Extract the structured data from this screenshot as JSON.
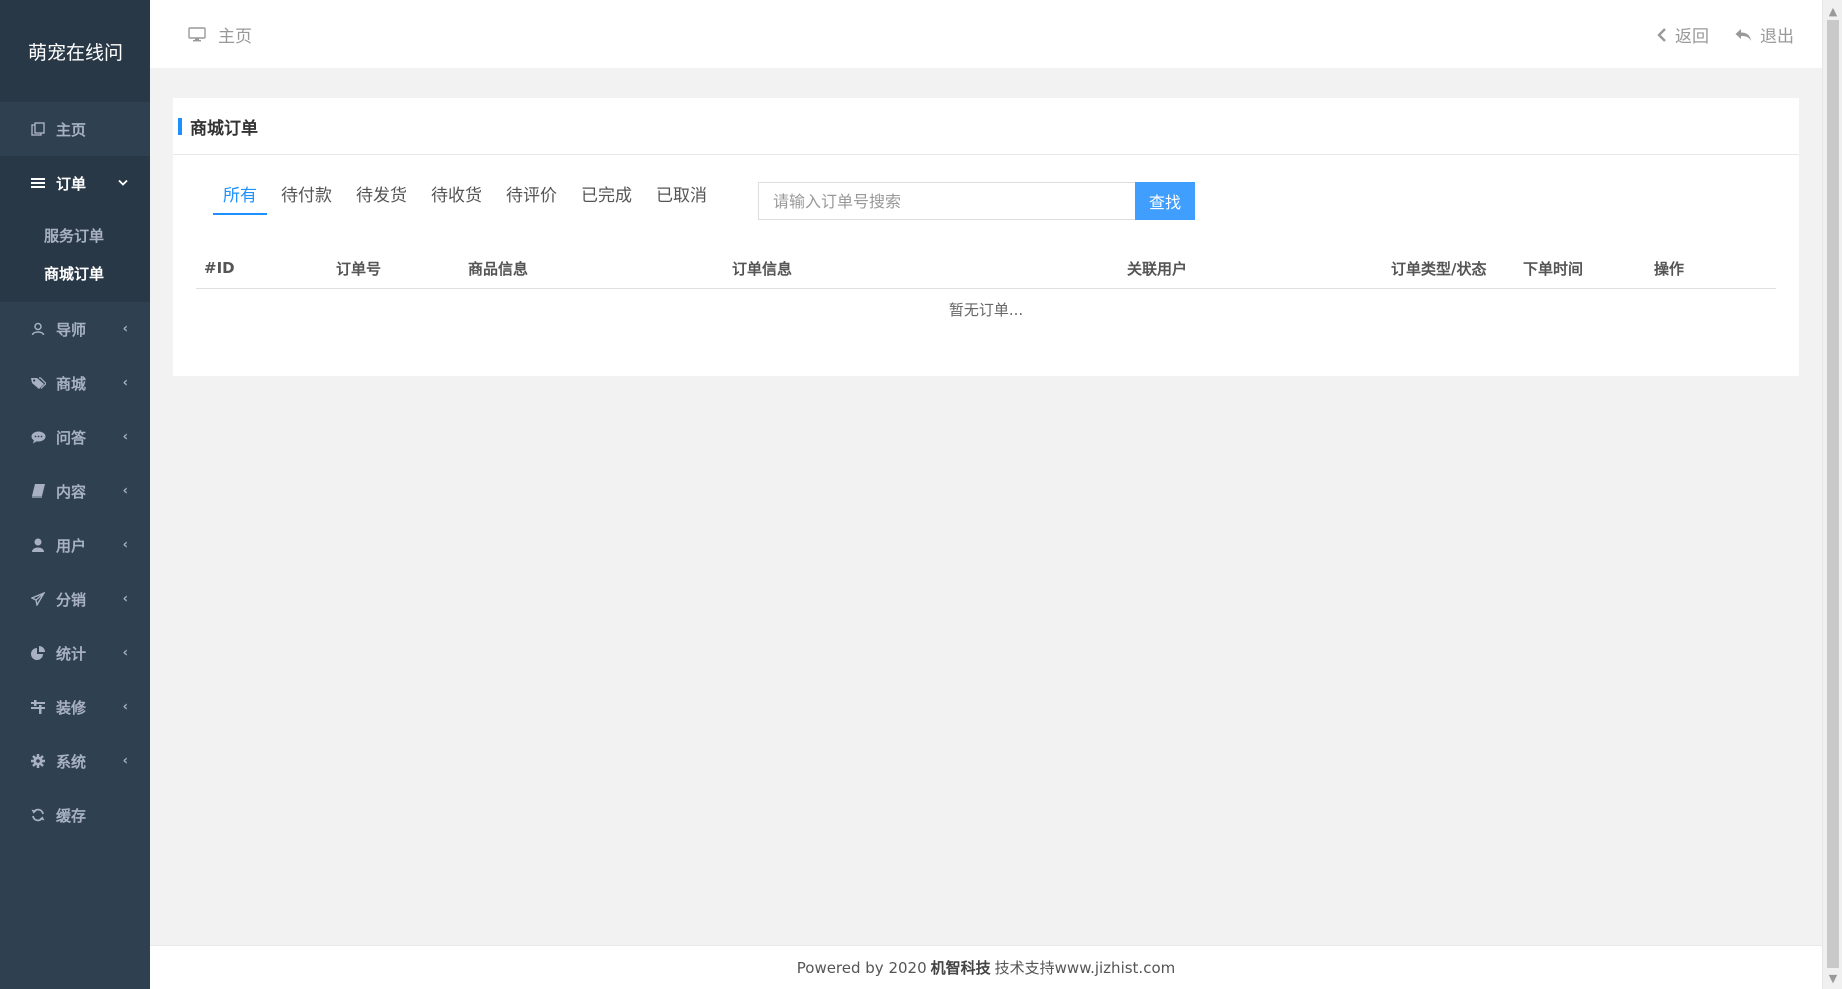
{
  "brand": "萌宠在线问",
  "sidebar": {
    "home": {
      "label": "主页",
      "icon": "copy-icon"
    },
    "orders": {
      "label": "订单",
      "icon": "list-icon",
      "children": [
        {
          "label": "服务订单"
        },
        {
          "label": "商城订单"
        }
      ]
    },
    "items": [
      {
        "label": "导师",
        "icon": "user-outline-icon"
      },
      {
        "label": "商城",
        "icon": "tags-icon"
      },
      {
        "label": "问答",
        "icon": "comment-icon"
      },
      {
        "label": "内容",
        "icon": "book-icon"
      },
      {
        "label": "用户",
        "icon": "user-icon"
      },
      {
        "label": "分销",
        "icon": "paper-plane-icon"
      },
      {
        "label": "统计",
        "icon": "pie-chart-icon"
      },
      {
        "label": "装修",
        "icon": "sliders-icon"
      },
      {
        "label": "系统",
        "icon": "gear-icon"
      },
      {
        "label": "缓存",
        "icon": "refresh-icon"
      }
    ]
  },
  "topbar": {
    "breadcrumb": "主页",
    "back_label": "返回",
    "logout_label": "退出"
  },
  "panel": {
    "title": "商城订单",
    "tabs": [
      "所有",
      "待付款",
      "待发货",
      "待收货",
      "待评价",
      "已完成",
      "已取消"
    ],
    "active_tab": "所有",
    "search": {
      "placeholder": "请输入订单号搜索",
      "value": "",
      "button": "查找"
    },
    "columns": [
      "#ID",
      "订单号",
      "商品信息",
      "订单信息",
      "关联用户",
      "订单类型/状态",
      "下单时间",
      "操作"
    ],
    "empty_text": "暂无订单..."
  },
  "footer": {
    "prefix": "Powered by 2020",
    "company": "机智科技",
    "suffix": "技术支持www.jizhist.com"
  },
  "colors": {
    "sidebar_bg": "#2f4050",
    "sidebar_dark": "#293846",
    "accent": "#1e90ff",
    "button": "#409eff"
  }
}
